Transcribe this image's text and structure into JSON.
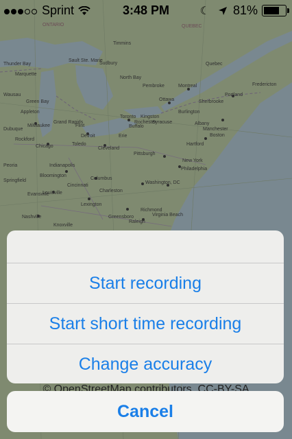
{
  "status_bar": {
    "carrier": "Sprint",
    "time": "3:48 PM",
    "battery_percent": "81%",
    "battery_level": 0.81,
    "signal_dots_filled": 3,
    "signal_dots_total": 5,
    "icons": [
      "signal-dots-icon",
      "wifi-icon",
      "moon-icon",
      "location-arrow-icon",
      "battery-icon"
    ]
  },
  "map": {
    "attribution": "© OpenStreetMap contributors, CC-BY-SA",
    "labels": [
      "ONTARIO",
      "QUEBEC",
      "Montreal",
      "Ottawa",
      "Toronto",
      "Detroit",
      "Chicago",
      "Milwaukee",
      "Cleveland",
      "Pittsburgh",
      "Buffalo",
      "Albany",
      "Boston",
      "New York",
      "Philadelphia",
      "Washington, DC",
      "Baltimore",
      "Richmond",
      "Virginia Beach",
      "Columbus",
      "Cincinnati",
      "Indianapolis",
      "Louisville",
      "Nashville",
      "Lexington",
      "Charleston",
      "Raleigh",
      "Portland",
      "Manchester",
      "Hartford",
      "Sudbury",
      "North Bay",
      "Pembroke",
      "Kingston",
      "Syracuse",
      "Rochester",
      "Erie",
      "Toledo",
      "Flint",
      "Grand Rapids",
      "Peoria",
      "Springfield",
      "Fredericton",
      "Quebec",
      "Sherbrooke",
      "Burlington",
      "Greensboro",
      "Knoxville",
      "Wausau",
      "Green Bay",
      "Appleton",
      "Dubuque",
      "Rockford",
      "Evansville",
      "Bloomington",
      "Marquette",
      "Sault Ste. Marie",
      "Thunder Bay",
      "Timmins"
    ]
  },
  "action_sheet": {
    "items": [
      {
        "label": "Start recording"
      },
      {
        "label": "Start short time recording"
      },
      {
        "label": "Change accuracy"
      }
    ],
    "cancel_label": "Cancel"
  },
  "colors": {
    "accent": "#1a7fe8",
    "land": "#a8b98f",
    "water": "#9fb8c6",
    "sheet": "#eeeeec"
  }
}
